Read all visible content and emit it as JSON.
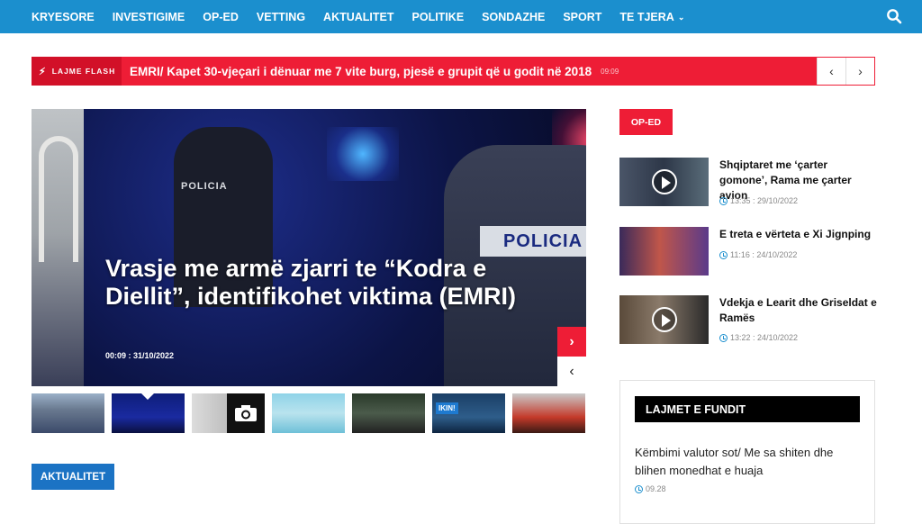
{
  "nav": {
    "items": [
      "KRYESORE",
      "INVESTIGIME",
      "OP-ED",
      "VETTING",
      "AKTUALITET",
      "POLITIKE",
      "SONDAZHE",
      "SPORT",
      "TE TJERA"
    ],
    "search_icon": "search-icon"
  },
  "flash": {
    "label": "LAJME FLASH",
    "headline": "EMRI/ Kapet 30-vjeçari i dënuar me 7 vite burg, pjesë e grupit që u godit në 2018",
    "time": "09:09",
    "prev": "‹",
    "next": "›"
  },
  "hero": {
    "title": "Vrasje me armë zjarri te “Kodra e Diellit”, identifikohet viktima (EMRI)",
    "date": "00:09 : 31/10/2022",
    "vest_small": "POLICIA",
    "vest_large": "POLICIA",
    "next_glyph": "›",
    "prev_glyph": "‹"
  },
  "thumbs": {
    "ikin": "IKIN!"
  },
  "section": {
    "aktualitet": "AKTUALITET"
  },
  "sidebar": {
    "op_badge": "OP-ED",
    "op_items": [
      {
        "title": "Shqiptaret me ‘çarter gomone’, Rama me çarter avion",
        "time": "13:35 : 29/10/2022",
        "video": true
      },
      {
        "title": "E treta e vërteta e Xi Jignping",
        "time": "11:16 : 24/10/2022",
        "video": false
      },
      {
        "title": "Vdekja e Learit dhe Griseldat e Ramës",
        "time": "13:22 : 24/10/2022",
        "video": true
      }
    ],
    "latest_header": "LAJMET E FUNDIT",
    "latest_title": "Këmbimi valutor sot/ Me sa shiten dhe blihen monedhat e huaja",
    "latest_time": "09.28"
  },
  "colors": {
    "nav_bg": "#1b8fce",
    "flash_red": "#ee1d36",
    "section_blue": "#1b73c4"
  }
}
